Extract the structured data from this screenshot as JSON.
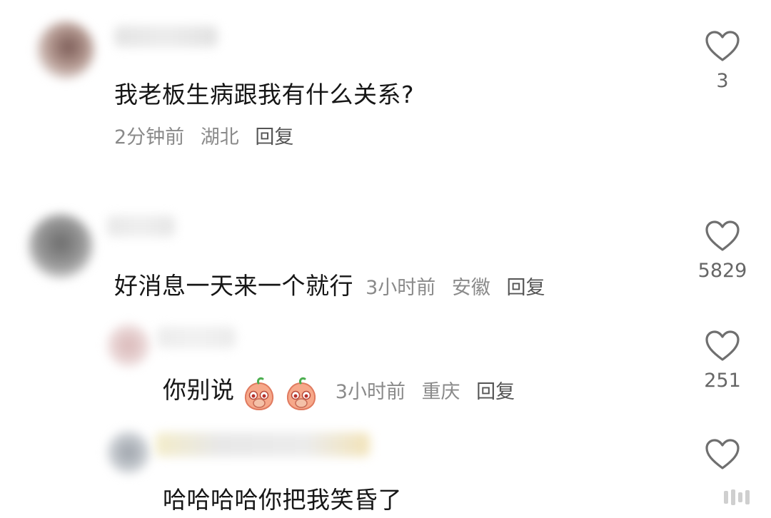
{
  "comments": [
    {
      "text": "我老板生病跟我有什么关系?",
      "time": "2分钟前",
      "location": "湖北",
      "reply": "回复",
      "likes": "3"
    },
    {
      "text": "好消息一天来一个就行",
      "time": "3小时前",
      "location": "安徽",
      "reply": "回复",
      "likes": "5829"
    },
    {
      "text": "你别说",
      "emojis": [
        "peach-cover-mouth-emoji",
        "peach-cover-mouth-emoji"
      ],
      "time": "3小时前",
      "location": "重庆",
      "reply": "回复",
      "likes": "251"
    },
    {
      "text": "哈哈哈哈你把我笑昏了"
    }
  ],
  "colors": {
    "text": "#161616",
    "meta": "#8a8a8a",
    "heart_outline": "#6f6f6f",
    "emoji_peach": "#f6a88a"
  }
}
